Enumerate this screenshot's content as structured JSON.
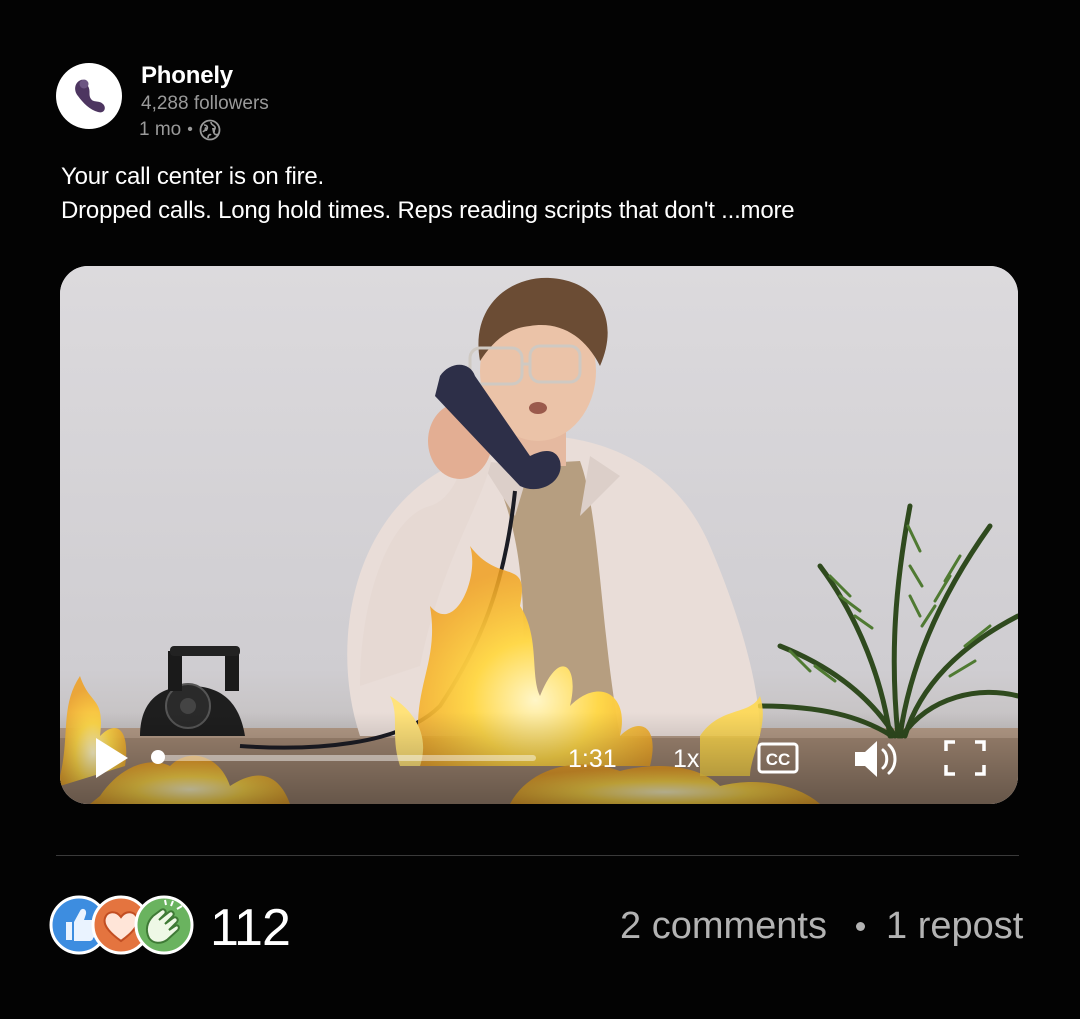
{
  "post": {
    "author": {
      "name": "Phonely",
      "followers": "4,288 followers",
      "time_ago": "1 mo",
      "meta_separator": "•",
      "visibility_icon": "globe-icon",
      "avatar_icon": "phone-handset-logo"
    },
    "text": {
      "line1": "Your call center is on fire.",
      "line2": "Dropped calls. Long hold times. Reps reading scripts that don't",
      "more_label": "...more"
    },
    "video": {
      "scene": "man on rotary phone at desk surrounded by flames, palm plant on right",
      "time": "1:31",
      "speed": "1x",
      "cc_label": "CC",
      "progress": 0.0,
      "play_icon": "play-icon",
      "volume_icon": "volume-icon",
      "fullscreen_icon": "fullscreen-icon"
    },
    "social": {
      "reaction_icons": [
        "like-icon",
        "love-icon",
        "celebrate-icon"
      ],
      "reaction_count": "112",
      "comments": "2 comments",
      "reposts": "1 repost"
    }
  },
  "colors": {
    "background": "#030303",
    "muted_text": "#9a9a9a",
    "like": "#3d8de0",
    "love": "#e4743f",
    "celebrate": "#6ab35f",
    "avatar_mark": "#5a3f6e"
  }
}
